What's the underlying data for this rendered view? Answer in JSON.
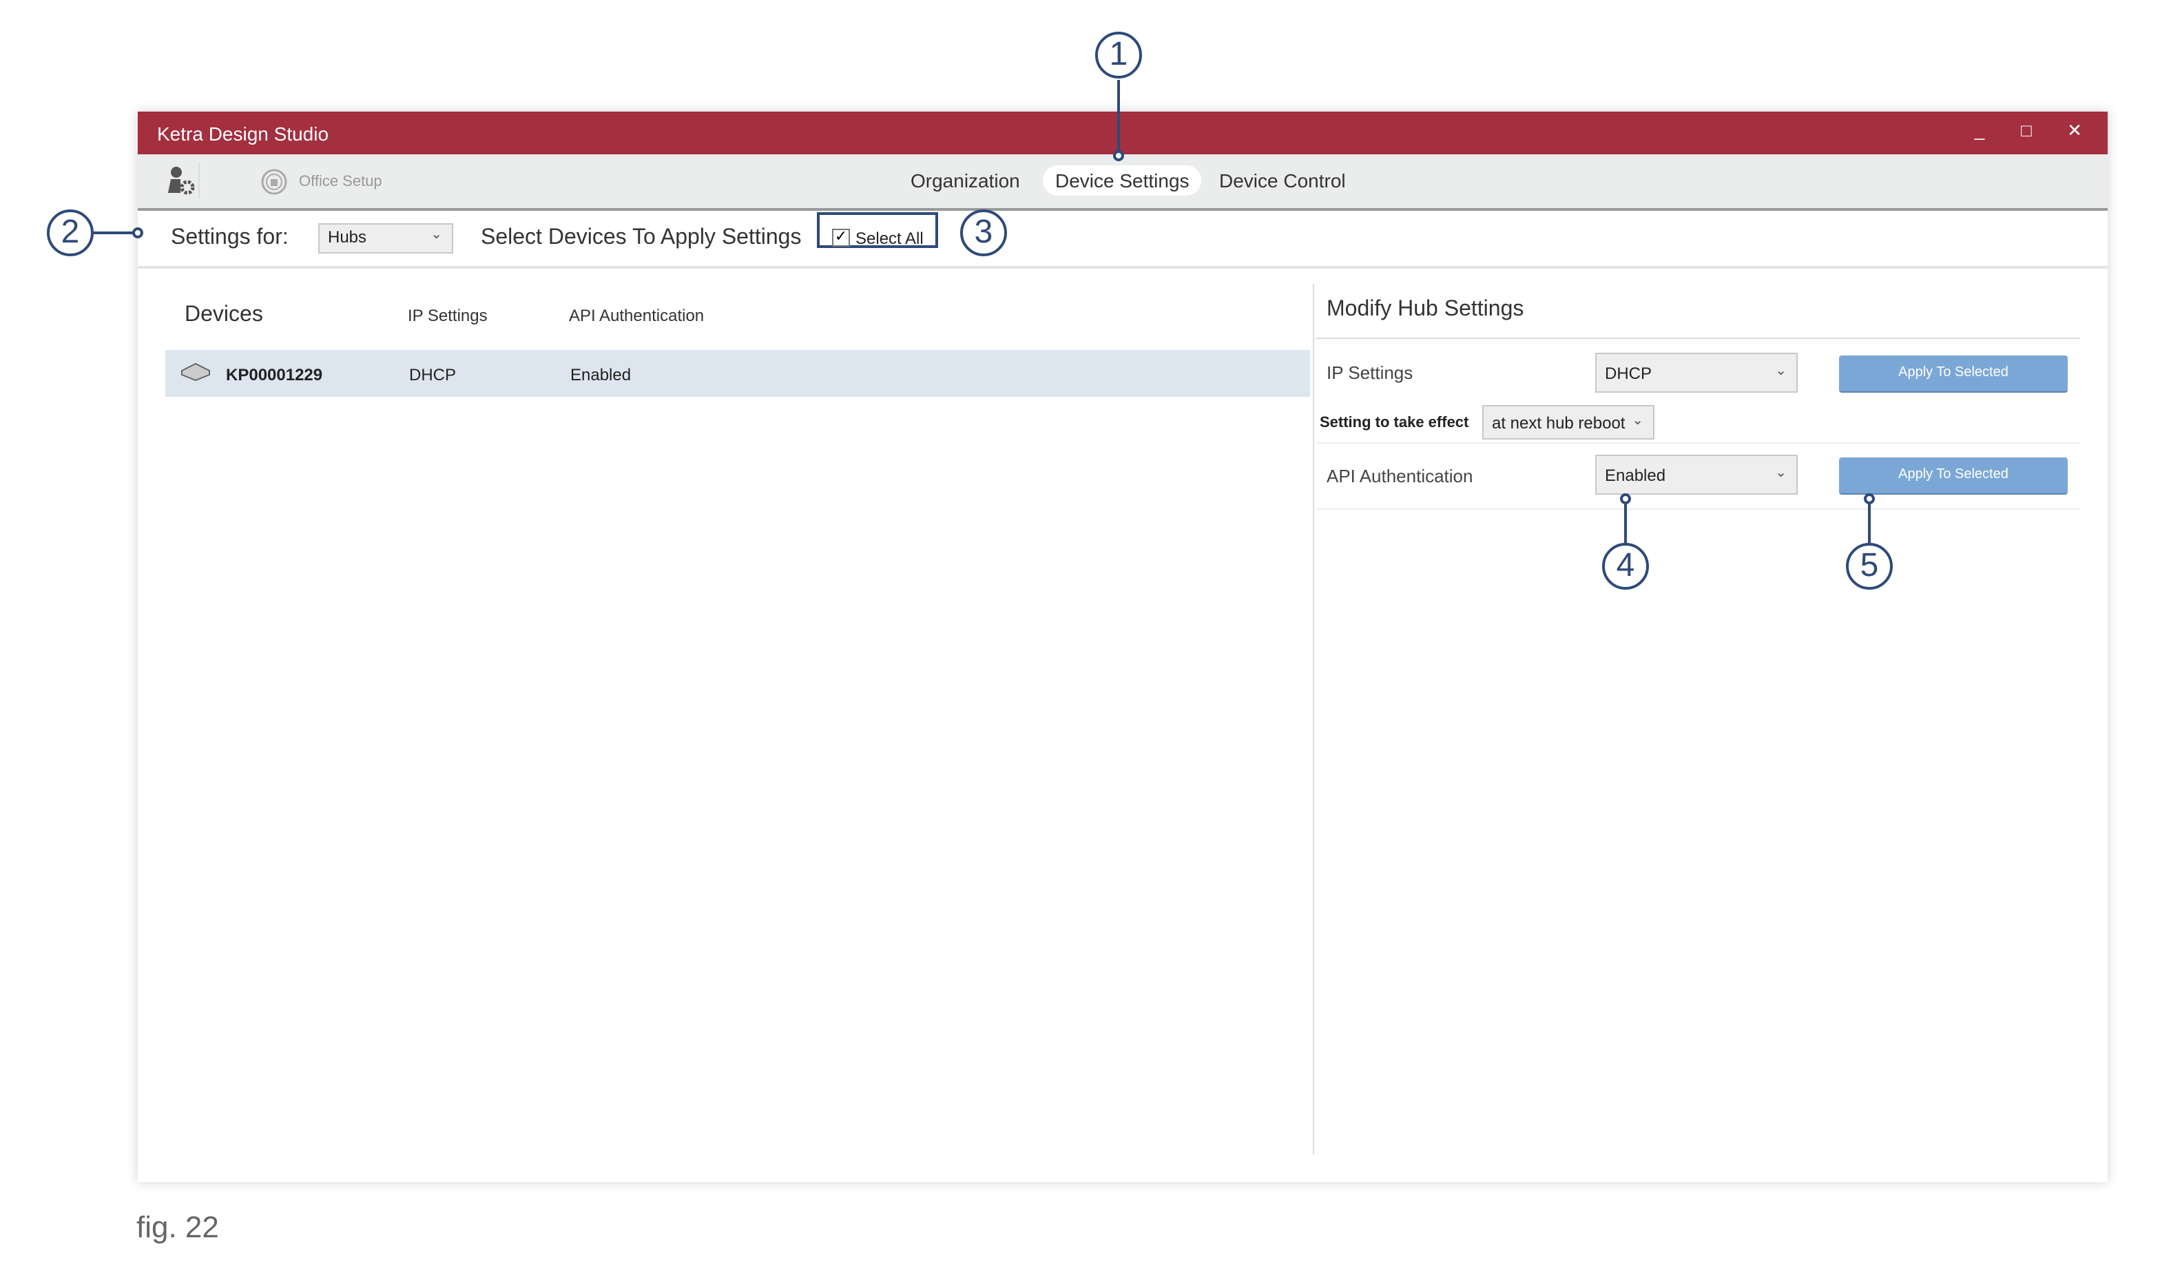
{
  "window": {
    "title": "Ketra Design Studio",
    "controls": {
      "minimize": "_",
      "maximize": "□",
      "close": "✕"
    }
  },
  "toolbar": {
    "office_setup": "Office Setup",
    "tabs": [
      {
        "label": "Organization",
        "active": false
      },
      {
        "label": "Device Settings",
        "active": true
      },
      {
        "label": "Device Control",
        "active": false
      }
    ]
  },
  "settings_row": {
    "settings_for_label": "Settings for:",
    "settings_for_value": "Hubs",
    "select_devices_label": "Select Devices To Apply Settings",
    "select_all_label": "Select All",
    "select_all_checked": true
  },
  "devices": {
    "columns": [
      "Devices",
      "IP Settings",
      "API Authentication"
    ],
    "rows": [
      {
        "name": "KP00001229",
        "ip": "DHCP",
        "api": "Enabled",
        "selected": true
      }
    ]
  },
  "modify": {
    "title": "Modify Hub Settings",
    "ip_label": "IP Settings",
    "ip_value": "DHCP",
    "apply_label": "Apply To Selected",
    "effect_label": "Setting to take effect",
    "effect_value": "at next hub reboot",
    "api_label": "API Authentication",
    "api_value": "Enabled"
  },
  "annotations": [
    "1",
    "2",
    "3",
    "4",
    "5"
  ],
  "caption": "fig. 22",
  "colors": {
    "titlebar": "#A32F3F",
    "annotation": "#2E4A7A",
    "button": "#7BA7D6",
    "selected_row": "#DDE5EE"
  }
}
